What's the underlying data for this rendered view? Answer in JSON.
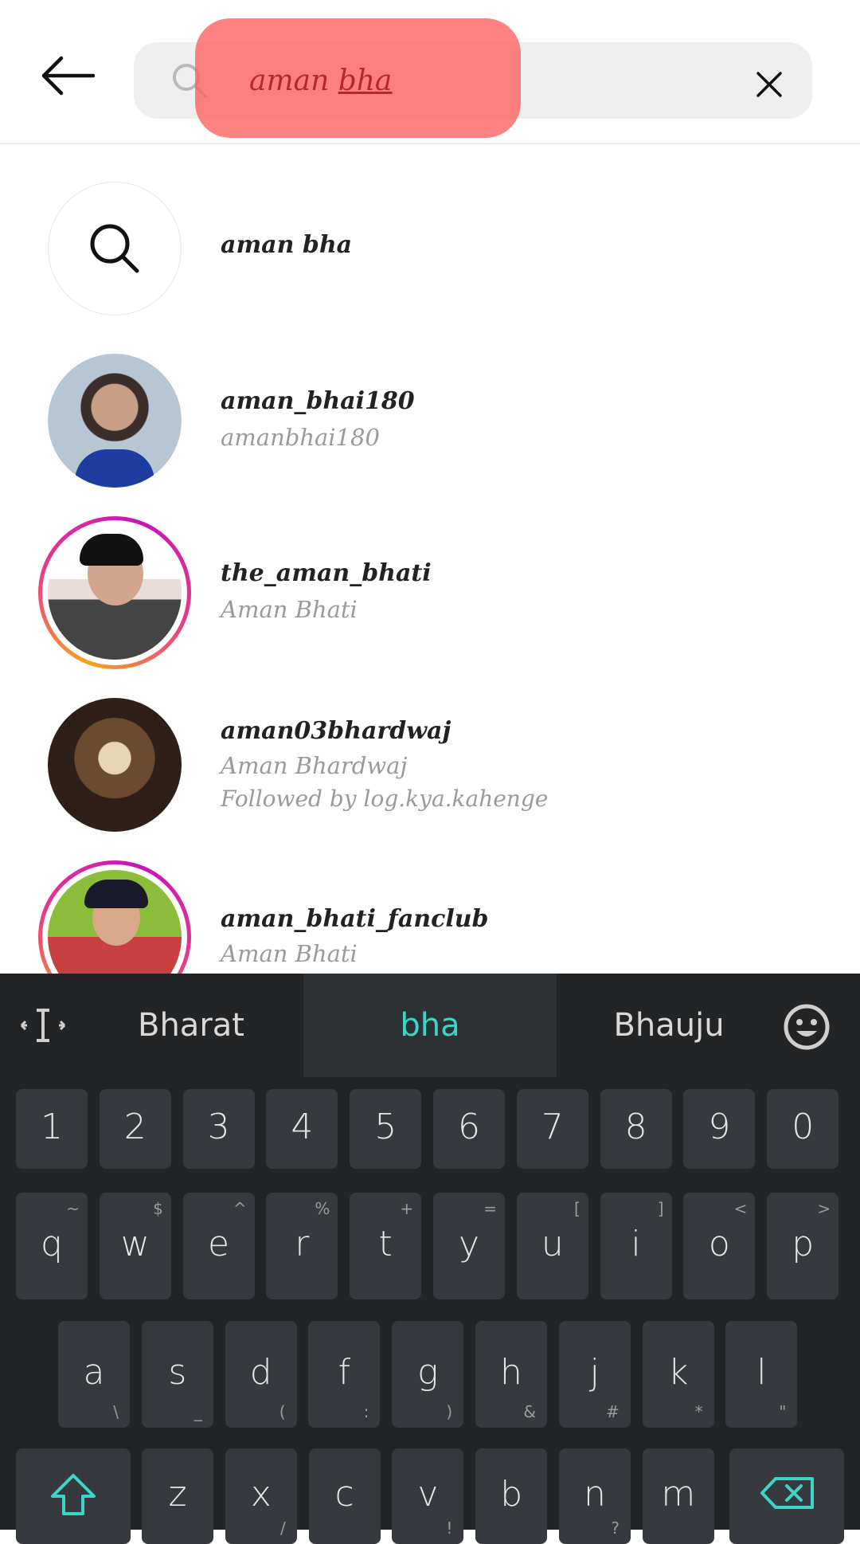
{
  "search": {
    "query_plain": "aman ",
    "query_underlined": "bha"
  },
  "suggestion_row": {
    "label": "aman bha"
  },
  "results": [
    {
      "username": "aman_bhai180",
      "fullname": "amanbhai180"
    },
    {
      "username": "the_aman_bhati",
      "fullname": "Aman Bhati"
    },
    {
      "username": "aman03bhardwaj",
      "fullname": "Aman Bhardwaj",
      "followed_by": "Followed by log.kya.kahenge"
    },
    {
      "username": "aman_bhati_fanclub",
      "fullname": "Aman Bhati"
    }
  ],
  "keyboard": {
    "suggestions": [
      "Bharat",
      "bha",
      "Bhauju"
    ],
    "active_suggestion_color": "#3dd6c6",
    "numbers": [
      "1",
      "2",
      "3",
      "4",
      "5",
      "6",
      "7",
      "8",
      "9",
      "0"
    ],
    "row1": [
      {
        "key": "q",
        "alt": "~"
      },
      {
        "key": "w",
        "alt": "$"
      },
      {
        "key": "e",
        "alt": "^"
      },
      {
        "key": "r",
        "alt": "%"
      },
      {
        "key": "t",
        "alt": "+"
      },
      {
        "key": "y",
        "alt": "="
      },
      {
        "key": "u",
        "alt": "["
      },
      {
        "key": "i",
        "alt": "]"
      },
      {
        "key": "o",
        "alt": "<"
      },
      {
        "key": "p",
        "alt": ">"
      }
    ],
    "row2": [
      {
        "key": "a",
        "alt": "\\"
      },
      {
        "key": "s",
        "alt": "_"
      },
      {
        "key": "d",
        "alt": "("
      },
      {
        "key": "f",
        "alt": ":"
      },
      {
        "key": "g",
        "alt": ")"
      },
      {
        "key": "h",
        "alt": "&"
      },
      {
        "key": "j",
        "alt": "#"
      },
      {
        "key": "k",
        "alt": "*"
      },
      {
        "key": "l",
        "alt": "\""
      }
    ],
    "row3": [
      {
        "key": "z",
        "alt": ""
      },
      {
        "key": "x",
        "alt": "/"
      },
      {
        "key": "c",
        "alt": ""
      },
      {
        "key": "v",
        "alt": "!"
      },
      {
        "key": "b",
        "alt": ""
      },
      {
        "key": "n",
        "alt": "?"
      },
      {
        "key": "m",
        "alt": ""
      }
    ]
  }
}
